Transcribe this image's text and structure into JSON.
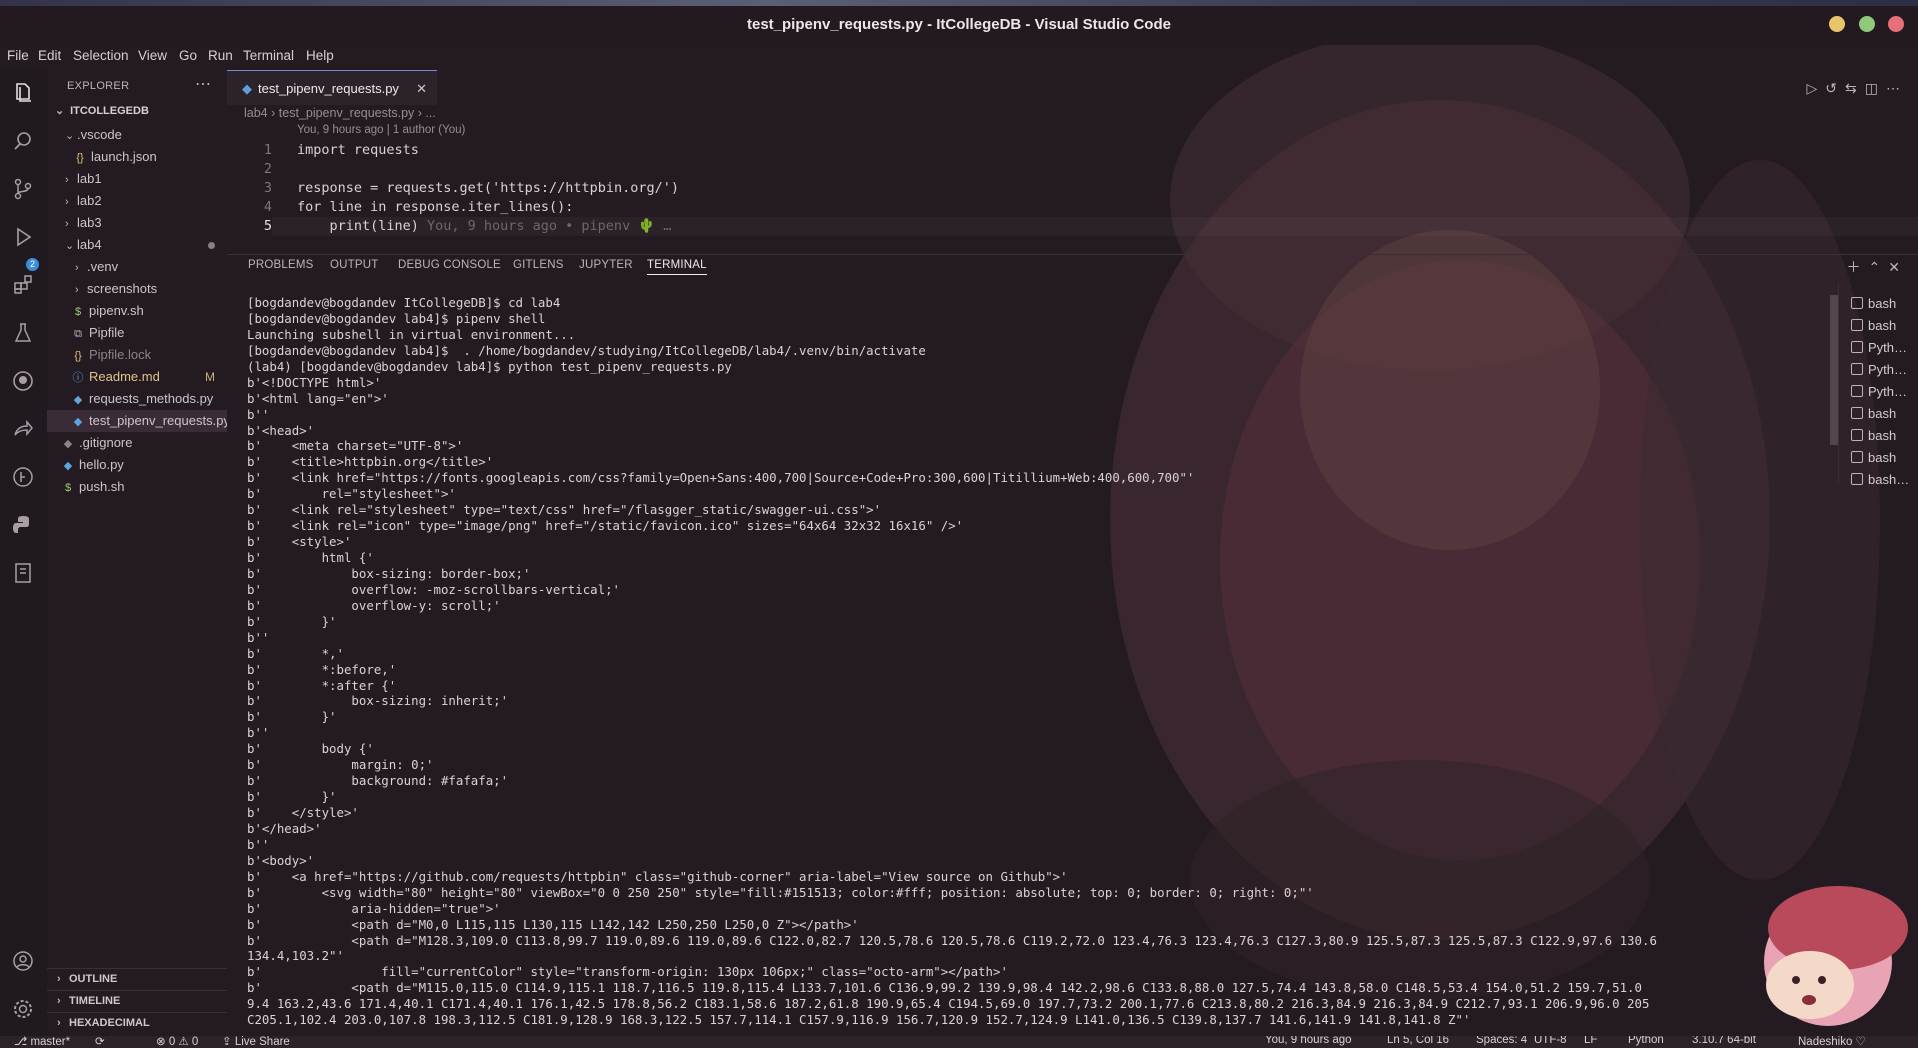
{
  "window": {
    "title": "test_pipenv_requests.py - ItCollegeDB - Visual Studio Code"
  },
  "menu": [
    "File",
    "Edit",
    "Selection",
    "View",
    "Go",
    "Run",
    "Terminal",
    "Help"
  ],
  "activity": {
    "scm_badge": "2"
  },
  "explorer": {
    "title": "EXPLORER",
    "more": "⋯",
    "root": "ITCOLLEGEDB",
    "items": [
      {
        "label": ".vscode",
        "chevron": "⌄"
      },
      {
        "label": "launch.json",
        "icon": "{}"
      },
      {
        "label": "lab1",
        "chevron": "›"
      },
      {
        "label": "lab2",
        "chevron": "›"
      },
      {
        "label": "lab3",
        "chevron": "›"
      },
      {
        "label": "lab4",
        "chevron": "⌄"
      },
      {
        "label": ".venv",
        "chevron": "›"
      },
      {
        "label": "screenshots",
        "chevron": "›"
      },
      {
        "label": "pipenv.sh",
        "icon": "$"
      },
      {
        "label": "Pipfile",
        "icon": "⧉"
      },
      {
        "label": "Pipfile.lock",
        "icon": "{}"
      },
      {
        "label": "Readme.md",
        "icon": "ⓘ",
        "badge": "M"
      },
      {
        "label": "requests_methods.py",
        "icon": "◆"
      },
      {
        "label": "test_pipenv_requests.py",
        "icon": "◆"
      },
      {
        "label": ".gitignore",
        "icon": "◆"
      },
      {
        "label": "hello.py",
        "icon": "◆"
      },
      {
        "label": "push.sh",
        "icon": "$"
      }
    ],
    "panels": [
      "OUTLINE",
      "TIMELINE",
      "HEXADECIMAL CALCULATOR"
    ]
  },
  "editor": {
    "tab": "test_pipenv_requests.py",
    "tab_close": "✕",
    "breadcrumb": [
      "lab4",
      "test_pipenv_requests.py",
      "..."
    ],
    "blame_header": "You, 9 hours ago | 1 author (You)",
    "lines": [
      {
        "n": "1",
        "code": "import requests"
      },
      {
        "n": "2",
        "code": ""
      },
      {
        "n": "3",
        "code": "response = requests.get('https://httpbin.org/')"
      },
      {
        "n": "4",
        "code": "for line in response.iter_lines():"
      },
      {
        "n": "5",
        "code": "    print(line)"
      }
    ],
    "inline_blame": "You, 9 hours ago • pipenv 🌵 …"
  },
  "panel": {
    "tabs": [
      "PROBLEMS",
      "OUTPUT",
      "DEBUG CONSOLE",
      "GITLENS",
      "JUPYTER",
      "TERMINAL"
    ],
    "active_tab": "TERMINAL",
    "terminal_lines": [
      "[bogdandev@bogdandev ItCollegeDB]$ cd lab4",
      "[bogdandev@bogdandev lab4]$ pipenv shell",
      "Launching subshell in virtual environment...",
      "[bogdandev@bogdandev lab4]$  . /home/bogdandev/studying/ItCollegeDB/lab4/.venv/bin/activate",
      "(lab4) [bogdandev@bogdandev lab4]$ python test_pipenv_requests.py",
      "b'<!DOCTYPE html>'",
      "b'<html lang=\"en\">'",
      "b''",
      "b'<head>'",
      "b'    <meta charset=\"UTF-8\">'",
      "b'    <title>httpbin.org</title>'",
      "b'    <link href=\"https://fonts.googleapis.com/css?family=Open+Sans:400,700|Source+Code+Pro:300,600|Titillium+Web:400,600,700\"'",
      "b'        rel=\"stylesheet\">'",
      "b'    <link rel=\"stylesheet\" type=\"text/css\" href=\"/flasgger_static/swagger-ui.css\">'",
      "b'    <link rel=\"icon\" type=\"image/png\" href=\"/static/favicon.ico\" sizes=\"64x64 32x32 16x16\" />'",
      "b'    <style>'",
      "b'        html {'",
      "b'            box-sizing: border-box;'",
      "b'            overflow: -moz-scrollbars-vertical;'",
      "b'            overflow-y: scroll;'",
      "b'        }'",
      "b''",
      "b'        *,'",
      "b'        *:before,'",
      "b'        *:after {'",
      "b'            box-sizing: inherit;'",
      "b'        }'",
      "b''",
      "b'        body {'",
      "b'            margin: 0;'",
      "b'            background: #fafafa;'",
      "b'        }'",
      "b'    </style>'",
      "b'</head>'",
      "b''",
      "b'<body>'",
      "b'    <a href=\"https://github.com/requests/httpbin\" class=\"github-corner\" aria-label=\"View source on Github\">'",
      "b'        <svg width=\"80\" height=\"80\" viewBox=\"0 0 250 250\" style=\"fill:#151513; color:#fff; position: absolute; top: 0; border: 0; right: 0;\"'",
      "b'            aria-hidden=\"true\">'",
      "b'            <path d=\"M0,0 L115,115 L130,115 L142,142 L250,250 L250,0 Z\"></path>'",
      "b'            <path d=\"M128.3,109.0 C113.8,99.7 119.0,89.6 119.0,89.6 C122.0,82.7 120.5,78.6 120.5,78.6 C119.2,72.0 123.4,76.3 123.4,76.3 C127.3,80.9 125.5,87.3 125.5,87.3 C122.9,97.6 130.6",
      "134.4,103.2\"'",
      "b'                fill=\"currentColor\" style=\"transform-origin: 130px 106px;\" class=\"octo-arm\"></path>'",
      "b'            <path d=\"M115.0,115.0 C114.9,115.1 118.7,116.5 119.8,115.4 L133.7,101.6 C136.9,99.2 139.9,98.4 142.2,98.6 C133.8,88.0 127.5,74.4 143.8,58.0 C148.5,53.4 154.0,51.2 159.7,51.0",
      "9.4 163.2,43.6 171.4,40.1 C171.4,40.1 176.1,42.5 178.8,56.2 C183.1,58.6 187.2,61.8 190.9,65.4 C194.5,69.0 197.7,73.2 200.1,77.6 C213.8,80.2 216.3,84.9 216.3,84.9 C212.7,93.1 206.9,96.0 205",
      "C205.1,102.4 203.0,107.8 198.3,112.5 C181.9,128.9 168.3,122.5 157.7,114.1 C157.9,116.9 156.7,120.9 152.7,124.9 L141.0,136.5 C139.8,137.7 141.6,141.9 141.8,141.8 Z\"'"
    ],
    "terminal_list": [
      "bash",
      "bash",
      "Pyth…",
      "Pyth…",
      "Pyth…",
      "bash",
      "bash",
      "bash",
      "bash…"
    ]
  },
  "status": {
    "branch": "master*",
    "sync": "⟳",
    "problems": "⊗ 0 ⚠ 0",
    "live_share": "Live Share",
    "blame": "You, 9 hours ago",
    "cursor": "Ln 5, Col 16",
    "spaces": "Spaces: 4",
    "encoding": "UTF-8",
    "eol": "LF",
    "language": "Python",
    "interpreter": "3.10.7 64-bit",
    "theme": "Nadeshiko ♡"
  }
}
